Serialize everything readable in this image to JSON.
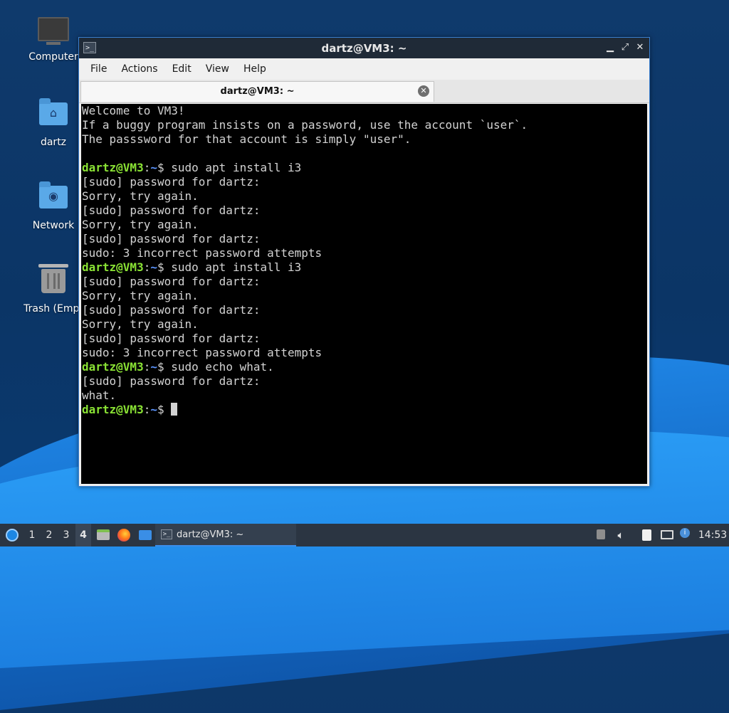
{
  "desktop": {
    "icons": [
      {
        "label": "Computer",
        "icon": "computer-icon"
      },
      {
        "label": "dartz",
        "icon": "home-folder-icon"
      },
      {
        "label": "Network",
        "icon": "network-folder-icon"
      },
      {
        "label": "Trash (Empt",
        "icon": "trash-icon"
      }
    ]
  },
  "window": {
    "title": "dartz@VM3: ~",
    "controls": {
      "minimize": "▁",
      "maximize": "⤢",
      "close": "✕"
    },
    "menu": [
      "File",
      "Actions",
      "Edit",
      "View",
      "Help"
    ],
    "tab": {
      "label": "dartz@VM3: ~",
      "close": "✕"
    }
  },
  "terminal": {
    "prompt": {
      "user": "dartz@VM3",
      "colon": ":",
      "path": "~",
      "symbol": "$ "
    },
    "lines": [
      {
        "type": "out",
        "text": "Welcome to VM3!"
      },
      {
        "type": "out",
        "text": "If a buggy program insists on a password, use the account `user`."
      },
      {
        "type": "out",
        "text": "The passsword for that account is simply \"user\"."
      },
      {
        "type": "out",
        "text": ""
      },
      {
        "type": "cmd",
        "text": "sudo apt install i3"
      },
      {
        "type": "out",
        "text": "[sudo] password for dartz:"
      },
      {
        "type": "out",
        "text": "Sorry, try again."
      },
      {
        "type": "out",
        "text": "[sudo] password for dartz:"
      },
      {
        "type": "out",
        "text": "Sorry, try again."
      },
      {
        "type": "out",
        "text": "[sudo] password for dartz:"
      },
      {
        "type": "out",
        "text": "sudo: 3 incorrect password attempts"
      },
      {
        "type": "cmd",
        "text": "sudo apt install i3"
      },
      {
        "type": "out",
        "text": "[sudo] password for dartz:"
      },
      {
        "type": "out",
        "text": "Sorry, try again."
      },
      {
        "type": "out",
        "text": "[sudo] password for dartz:"
      },
      {
        "type": "out",
        "text": "Sorry, try again."
      },
      {
        "type": "out",
        "text": "[sudo] password for dartz:"
      },
      {
        "type": "out",
        "text": "sudo: 3 incorrect password attempts"
      },
      {
        "type": "cmd",
        "text": "sudo echo what."
      },
      {
        "type": "out",
        "text": "[sudo] password for dartz:"
      },
      {
        "type": "out",
        "text": "what."
      },
      {
        "type": "cmd",
        "text": "",
        "cursor": true
      }
    ]
  },
  "taskbar": {
    "workspaces": [
      "1",
      "2",
      "3",
      "4"
    ],
    "active_workspace": "4",
    "task_label": "dartz@VM3: ~",
    "clock": "14:53"
  }
}
